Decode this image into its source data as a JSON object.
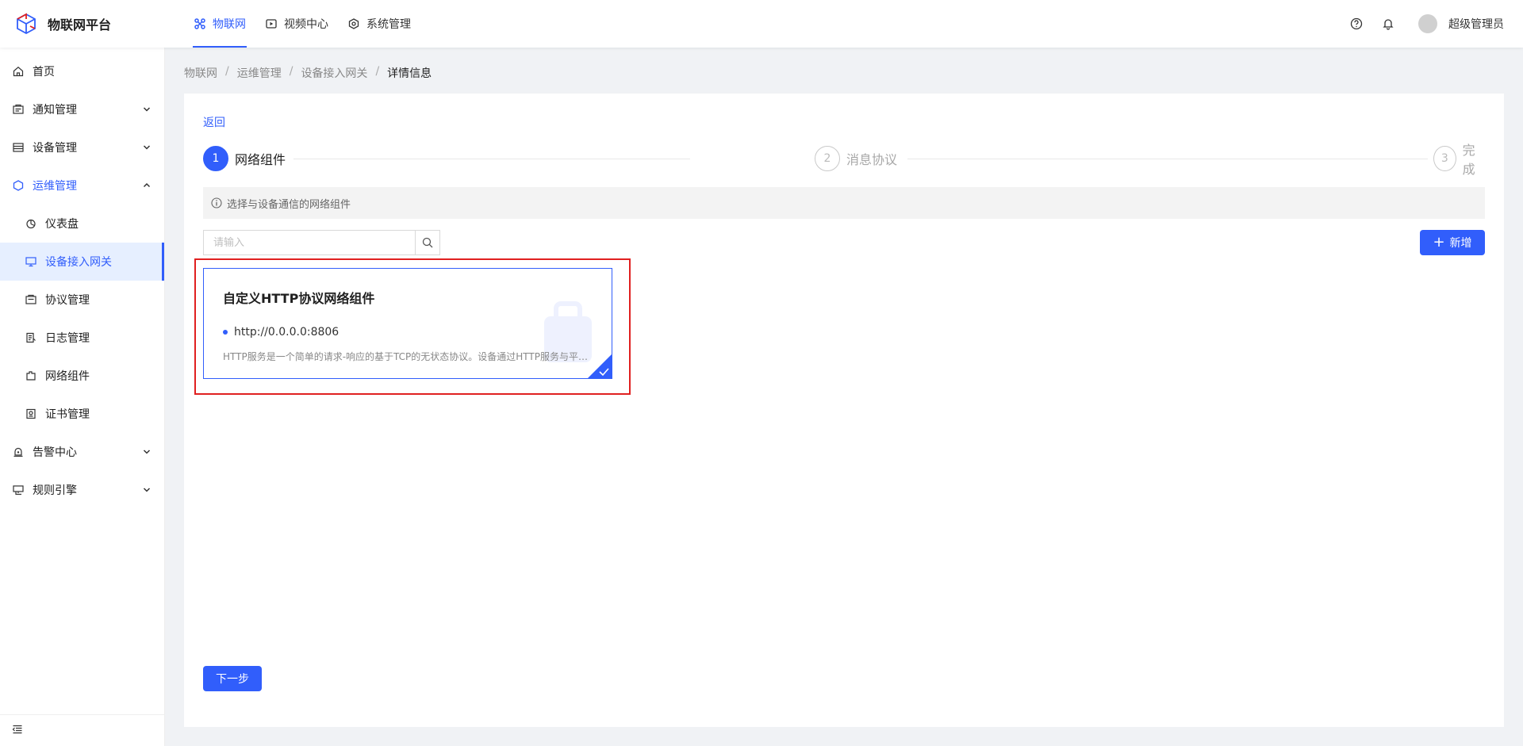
{
  "app": {
    "name": "物联网平台"
  },
  "topnav": [
    {
      "label": "物联网",
      "icon": "iot-icon"
    },
    {
      "label": "视频中心",
      "icon": "video-icon"
    },
    {
      "label": "系统管理",
      "icon": "system-icon"
    }
  ],
  "header": {
    "username": "超级管理员"
  },
  "sidebar": {
    "items": [
      {
        "label": "首页",
        "icon": "home-icon"
      },
      {
        "label": "通知管理",
        "icon": "notice-icon"
      },
      {
        "label": "设备管理",
        "icon": "device-icon"
      },
      {
        "label": "运维管理",
        "icon": "ops-icon"
      },
      {
        "label": "告警中心",
        "icon": "alarm-icon"
      },
      {
        "label": "规则引擎",
        "icon": "rule-icon"
      }
    ],
    "sub": [
      {
        "label": "仪表盘",
        "icon": "dashboard-icon"
      },
      {
        "label": "设备接入网关",
        "icon": "gateway-icon"
      },
      {
        "label": "协议管理",
        "icon": "protocol-icon"
      },
      {
        "label": "日志管理",
        "icon": "log-icon"
      },
      {
        "label": "网络组件",
        "icon": "network-icon"
      },
      {
        "label": "证书管理",
        "icon": "certificate-icon"
      }
    ]
  },
  "breadcrumb": [
    "物联网",
    "运维管理",
    "设备接入网关",
    "详情信息"
  ],
  "page": {
    "back": "返回",
    "steps": [
      {
        "num": "1",
        "title": "网络组件"
      },
      {
        "num": "2",
        "title": "消息协议"
      },
      {
        "num": "3",
        "title": "完成"
      }
    ],
    "alert": "选择与设备通信的网络组件",
    "search_placeholder": "请输入",
    "add_label": "新增",
    "card": {
      "title": "自定义HTTP协议网络组件",
      "address": "http://0.0.0.0:8806",
      "desc": "HTTP服务是一个简单的请求-响应的基于TCP的无状态协议。设备通过HTTP服务与平台进行灵活的短连接通信"
    },
    "next_label": "下一步"
  },
  "colors": {
    "primary": "#315efb",
    "highlight": "#e02020"
  }
}
